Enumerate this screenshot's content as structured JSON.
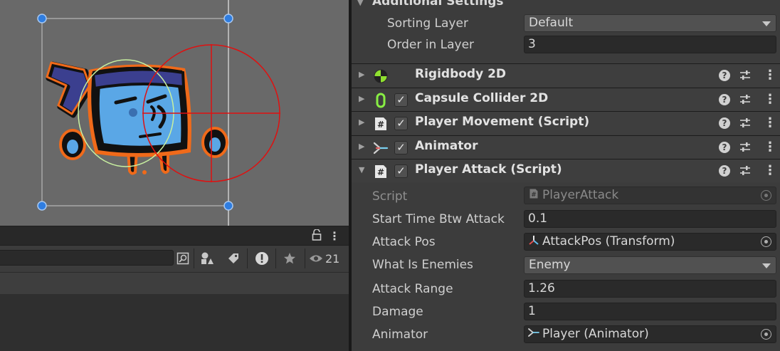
{
  "inspector": {
    "additional_settings": {
      "header": "Additional Settings",
      "sorting_layer_label": "Sorting Layer",
      "sorting_layer_value": "Default",
      "order_in_layer_label": "Order in Layer",
      "order_in_layer_value": "3"
    },
    "components": [
      {
        "title": "Rigidbody 2D",
        "icon": "rigidbody-icon",
        "has_checkbox": false,
        "expanded": false
      },
      {
        "title": "Capsule Collider 2D",
        "icon": "capsule-collider-icon",
        "has_checkbox": true,
        "expanded": false
      },
      {
        "title": "Player Movement (Script)",
        "icon": "script-icon",
        "has_checkbox": true,
        "expanded": false
      },
      {
        "title": "Animator",
        "icon": "animator-icon",
        "has_checkbox": true,
        "expanded": false
      },
      {
        "title": "Player Attack (Script)",
        "icon": "script-icon",
        "has_checkbox": true,
        "expanded": true
      }
    ],
    "player_attack": {
      "script_label": "Script",
      "script_value": "PlayerAttack",
      "start_time_label": "Start Time Btw Attack",
      "start_time_value": "0.1",
      "attack_pos_label": "Attack Pos",
      "attack_pos_value": "AttackPos (Transform)",
      "enemies_label": "What Is Enemies",
      "enemies_value": "Enemy",
      "range_label": "Attack Range",
      "range_value": "1.26",
      "damage_label": "Damage",
      "damage_value": "1",
      "animator_label": "Animator",
      "animator_value": "Player (Animator)"
    }
  },
  "project_panel": {
    "hidden_count": "21",
    "icons": [
      "lock-icon",
      "kebab-menu-icon",
      "search-by-type-icon",
      "filter-by-type-icon",
      "filter-by-label-icon",
      "error-filter-icon",
      "favorite-icon",
      "visibility-icon"
    ]
  },
  "colors": {
    "gizmo_red": "#e01010",
    "sprite_fill": "#5aa7e6",
    "sprite_outline": "#f06a1a",
    "headband": "#3b3f8f",
    "handle_blue": "#2f7de0",
    "capsule_collider": "#c8f0a0",
    "rigidbody_icon": "#8fe030",
    "capsule_icon": "#88ee44",
    "check_color": "#e8e8e8"
  }
}
